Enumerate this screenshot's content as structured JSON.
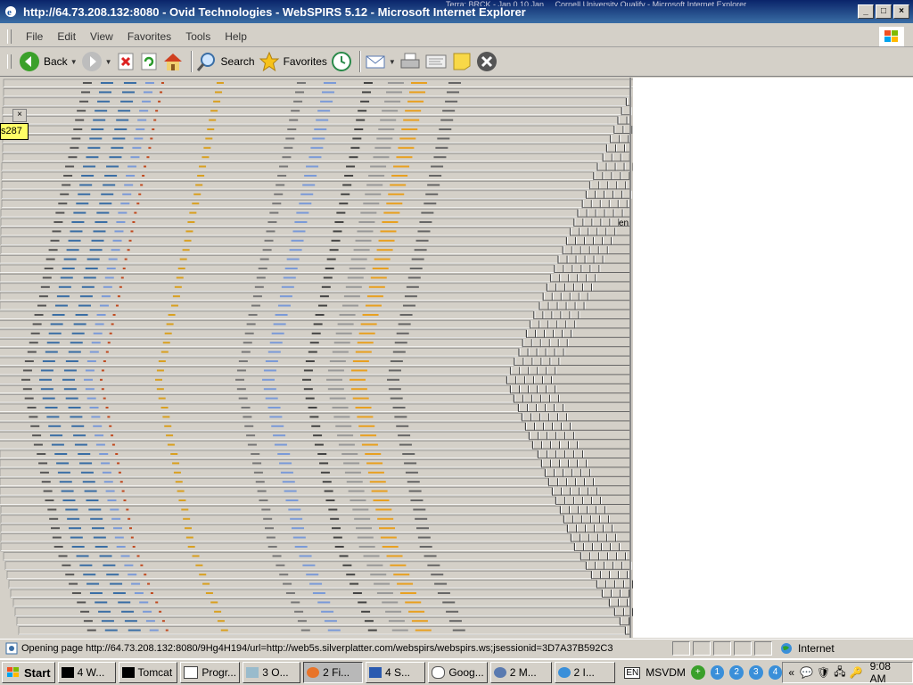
{
  "window": {
    "title": "http://64.73.208.132:8080 - Ovid Technologies - WebSPIRS 5.12 - Microsoft Internet Explorer",
    "overlay_text": "Terra: BRCK - Jan 0 10 Jan ... Cornell University Qualify - Microsoft Internet Explorer"
  },
  "menu": [
    "File",
    "Edit",
    "View",
    "Favorites",
    "Tools",
    "Help"
  ],
  "toolbar": {
    "back": "Back",
    "search": "Search",
    "favorites": "Favorites"
  },
  "popup": {
    "close": "×",
    "text": "s287"
  },
  "stray_text": "en",
  "status": {
    "text": "Opening page http://64.73.208.132:8080/9Hg4H194/url=http://web5s.silverplatter.com/webspirs/webspirs.ws;jsessionid=3D7A37B592C3",
    "zone": "Internet"
  },
  "taskbar": {
    "start": "Start",
    "tasks": [
      "4 W...",
      "Tomcat",
      "Progr...",
      "3 O...",
      "2 Fi...",
      "4 S...",
      "Goog...",
      "2 M...",
      "2 I..."
    ],
    "lang": "EN",
    "vdm": "MSVDM",
    "desktops": [
      "1",
      "2",
      "3",
      "4"
    ],
    "clock": "9:08 AM"
  }
}
